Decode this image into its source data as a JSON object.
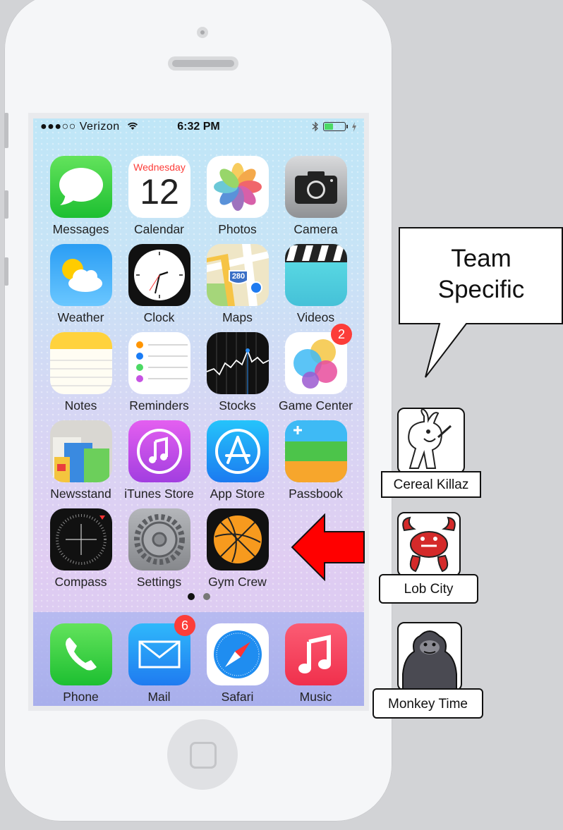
{
  "status_bar": {
    "carrier": "●●●○○ Verizon",
    "time": "6:32 PM"
  },
  "apps": [
    {
      "label": "Messages",
      "icon": "messages-icon"
    },
    {
      "label": "Calendar",
      "icon": "calendar-icon",
      "weekday": "Wednesday",
      "day": "12"
    },
    {
      "label": "Photos",
      "icon": "photos-icon"
    },
    {
      "label": "Camera",
      "icon": "camera-icon"
    },
    {
      "label": "Weather",
      "icon": "weather-icon"
    },
    {
      "label": "Clock",
      "icon": "clock-icon"
    },
    {
      "label": "Maps",
      "icon": "maps-icon",
      "route": "280"
    },
    {
      "label": "Videos",
      "icon": "videos-icon"
    },
    {
      "label": "Notes",
      "icon": "notes-icon"
    },
    {
      "label": "Reminders",
      "icon": "reminders-icon"
    },
    {
      "label": "Stocks",
      "icon": "stocks-icon"
    },
    {
      "label": "Game Center",
      "icon": "game-center-icon",
      "badge": "2"
    },
    {
      "label": "Newsstand",
      "icon": "newsstand-icon"
    },
    {
      "label": "iTunes Store",
      "icon": "itunes-store-icon"
    },
    {
      "label": "App Store",
      "icon": "app-store-icon"
    },
    {
      "label": "Passbook",
      "icon": "passbook-icon"
    },
    {
      "label": "Compass",
      "icon": "compass-icon"
    },
    {
      "label": "Settings",
      "icon": "settings-icon"
    },
    {
      "label": "Gym Crew",
      "icon": "basketball-icon"
    }
  ],
  "dock": [
    {
      "label": "Phone",
      "icon": "phone-icon"
    },
    {
      "label": "Mail",
      "icon": "mail-icon",
      "badge": "6"
    },
    {
      "label": "Safari",
      "icon": "safari-icon"
    },
    {
      "label": "Music",
      "icon": "music-icon"
    }
  ],
  "page_dots": {
    "count": 2,
    "active": 1
  },
  "callout": {
    "line1": "Team",
    "line2": "Specific"
  },
  "teams": [
    {
      "name": "Cereal Killaz",
      "logo": "rabbit-logo"
    },
    {
      "name": "Lob City",
      "logo": "crab-logo"
    },
    {
      "name": "Monkey Time",
      "logo": "gorilla-logo"
    }
  ],
  "colors": {
    "arrow": "#ff0000",
    "badge": "#fc3d39"
  }
}
